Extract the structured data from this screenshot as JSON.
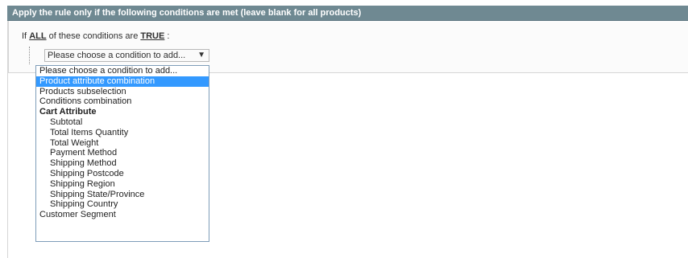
{
  "header": {
    "title": "Apply the rule only if the following conditions are met (leave blank for all products)"
  },
  "conditions": {
    "if_label": "If",
    "aggregator_value": "ALL",
    "middle_text": "of these conditions are",
    "value_label": "TRUE",
    "colon": ":"
  },
  "select": {
    "current_value": "Please choose a condition to add...",
    "arrow": "▼"
  },
  "dropdown": {
    "options": [
      "Please choose a condition to add...",
      "Product attribute combination",
      "Products subselection",
      "Conditions combination",
      "Cart Attribute",
      "Subtotal",
      "Total Items Quantity",
      "Total Weight",
      "Payment Method",
      "Shipping Method",
      "Shipping Postcode",
      "Shipping Region",
      "Shipping State/Province",
      "Shipping Country",
      "Customer Segment"
    ],
    "selected_index": 1
  },
  "colors": {
    "header_bg": "#6f8992",
    "selection_bg": "#3399ff",
    "border": "#d6d6d6"
  },
  "icons": {
    "select_arrow": "chevron-down-icon"
  }
}
